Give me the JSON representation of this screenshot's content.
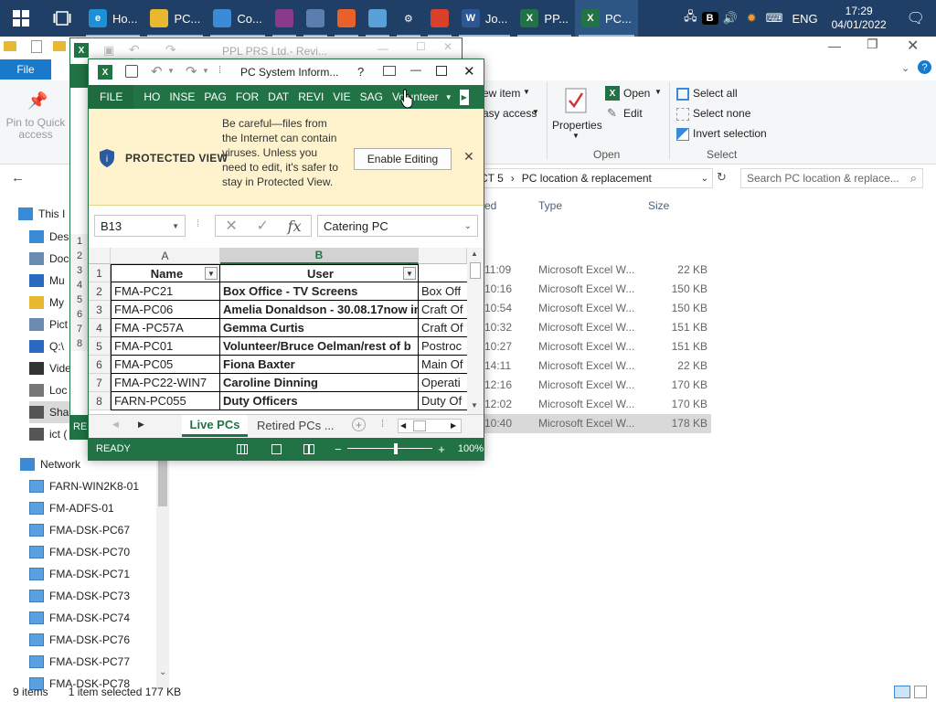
{
  "taskbar": {
    "apps": [
      {
        "label": "Ho...",
        "icon": "edge-icon",
        "color": "#1e90d6",
        "glyph": "e"
      },
      {
        "label": "PC...",
        "icon": "folder-icon",
        "color": "#e8b830",
        "glyph": ""
      },
      {
        "label": "Co...",
        "icon": "control-panel-icon",
        "color": "#3a8ad6",
        "glyph": ""
      },
      {
        "label": "",
        "icon": "winrar-icon",
        "color": "#8a3a8a",
        "glyph": ""
      },
      {
        "label": "",
        "icon": "app-window-icon",
        "color": "#5a7fae",
        "glyph": ""
      },
      {
        "label": "",
        "icon": "firefox-icon",
        "color": "#e8602a",
        "glyph": ""
      },
      {
        "label": "",
        "icon": "paint-icon",
        "color": "#5aa0d8",
        "glyph": ""
      },
      {
        "label": "",
        "icon": "settings-icon",
        "color": "#1f3f66",
        "glyph": "⚙"
      },
      {
        "label": "",
        "icon": "chrome-icon",
        "color": "#d9402a",
        "glyph": ""
      },
      {
        "label": "Jo...",
        "icon": "word-icon",
        "color": "#2b5797",
        "glyph": "W"
      },
      {
        "label": "PP...",
        "icon": "excel-icon",
        "color": "#217346",
        "glyph": "X"
      },
      {
        "label": "PC...",
        "icon": "excel-icon",
        "color": "#217346",
        "glyph": "X"
      }
    ],
    "language": "ENG",
    "time": "17:29",
    "date": "04/01/2022"
  },
  "explorer": {
    "file_tab": "File",
    "back_window_title": "PPL PRS Ltd.- Revi...",
    "pin_label": "Pin to Quick access",
    "new_item": "ew item",
    "easy_access": "asy access",
    "properties": "Properties",
    "open": "Open",
    "edit": "Edit",
    "open_group": "Open",
    "select_all": "Select all",
    "select_none": "Select none",
    "invert_selection": "Invert selection",
    "select_group": "Select",
    "address_prefix": "CT 5",
    "address_folder": "PC location & replacement",
    "search_placeholder": "Search PC location & replace...",
    "columns": {
      "modified": "ed",
      "type": "Type",
      "size": "Size"
    },
    "files": [
      {
        "time": "11:09",
        "type": "Microsoft Excel W...",
        "size": "22 KB"
      },
      {
        "time": "10:16",
        "type": "Microsoft Excel W...",
        "size": "150 KB"
      },
      {
        "time": "10:54",
        "type": "Microsoft Excel W...",
        "size": "150 KB"
      },
      {
        "time": "10:32",
        "type": "Microsoft Excel W...",
        "size": "151 KB"
      },
      {
        "time": "10:27",
        "type": "Microsoft Excel W...",
        "size": "151 KB"
      },
      {
        "time": "14:11",
        "type": "Microsoft Excel W...",
        "size": "22 KB"
      },
      {
        "time": "12:16",
        "type": "Microsoft Excel W...",
        "size": "170 KB"
      },
      {
        "time": "12:02",
        "type": "Microsoft Excel W...",
        "size": "170 KB"
      },
      {
        "time": "10:40",
        "type": "Microsoft Excel W...",
        "size": "178 KB"
      }
    ],
    "nav": [
      {
        "label": "This I",
        "icon": "pc-icon"
      },
      {
        "label": "Des",
        "icon": "desktop-icon"
      },
      {
        "label": "Doc",
        "icon": "documents-icon"
      },
      {
        "label": "Mu",
        "icon": "music-icon"
      },
      {
        "label": "My",
        "icon": "folder-icon"
      },
      {
        "label": "Pict",
        "icon": "pictures-icon"
      },
      {
        "label": "Q:\\",
        "icon": "drive-icon"
      },
      {
        "label": "Vide",
        "icon": "videos-icon"
      },
      {
        "label": "Loc",
        "icon": "local-disk-icon"
      },
      {
        "label": "Sha",
        "icon": "share-icon"
      },
      {
        "label": "ict (",
        "icon": "network-drive-icon"
      }
    ],
    "network_label": "Network",
    "network_items": [
      "FARN-WIN2K8-01",
      "FM-ADFS-01",
      "FMA-DSK-PC67",
      "FMA-DSK-PC70",
      "FMA-DSK-PC71",
      "FMA-DSK-PC73",
      "FMA-DSK-PC74",
      "FMA-DSK-PC76",
      "FMA-DSK-PC77",
      "FMA-DSK-PC78"
    ],
    "status_items": "9 items",
    "status_selected": "1 item selected  177 KB"
  },
  "excel": {
    "title": "PC System Inform...",
    "help": "?",
    "tabs": [
      "FILE",
      "HO",
      "INSE",
      "PAG",
      "FOR",
      "DAT",
      "REVI",
      "VIE",
      "SAG",
      "Volunteer"
    ],
    "protected_label": "PROTECTED VIEW",
    "protected_msg": "Be careful—files from the Internet can contain viruses. Unless you need to edit, it's safer to stay in Protected View.",
    "enable_editing": "Enable Editing",
    "name_box": "B13",
    "formula_value": "Catering PC",
    "columns": [
      "A",
      "B"
    ],
    "row_numbers": [
      "1",
      "2",
      "3",
      "4",
      "5",
      "6",
      "7",
      "8"
    ],
    "header": {
      "name": "Name",
      "user": "User"
    },
    "rows": [
      {
        "name": "FMA-PC21",
        "user": "Box Office - TV Screens",
        "loc": "Box Off"
      },
      {
        "name": "FMA-PC06",
        "user": "Amelia Donaldson - 30.08.17now in",
        "loc": "Craft Of"
      },
      {
        "name": "FMA -PC57A",
        "user": "Gemma Curtis",
        "loc": "Craft Of"
      },
      {
        "name": "FMA-PC01",
        "user": "Volunteer/Bruce Oelman/rest of b",
        "loc": "Postroc"
      },
      {
        "name": "FMA-PC05",
        "user": "Fiona Baxter",
        "loc": "Main Of"
      },
      {
        "name": "FMA-PC22-WIN7",
        "user": "Caroline Dinning",
        "loc": "Operati"
      },
      {
        "name": "FARN-PC055",
        "user": "Duty Officers",
        "loc": "Duty Of"
      }
    ],
    "back_rows": [
      "1",
      "2",
      "3",
      "4",
      "5",
      "6",
      "7",
      "8"
    ],
    "sheet_live": "Live PCs",
    "sheet_retired": "Retired PCs",
    "sheet_more": "...",
    "status_ready": "READY",
    "back_status": "RE",
    "zoom": "100%",
    "zoom_fraction": 0.5
  },
  "colors": {
    "excel_green": "#217346",
    "taskbar": "#1f3f66",
    "protected_bg": "#fff3cd",
    "accent_blue": "#1979ca"
  }
}
